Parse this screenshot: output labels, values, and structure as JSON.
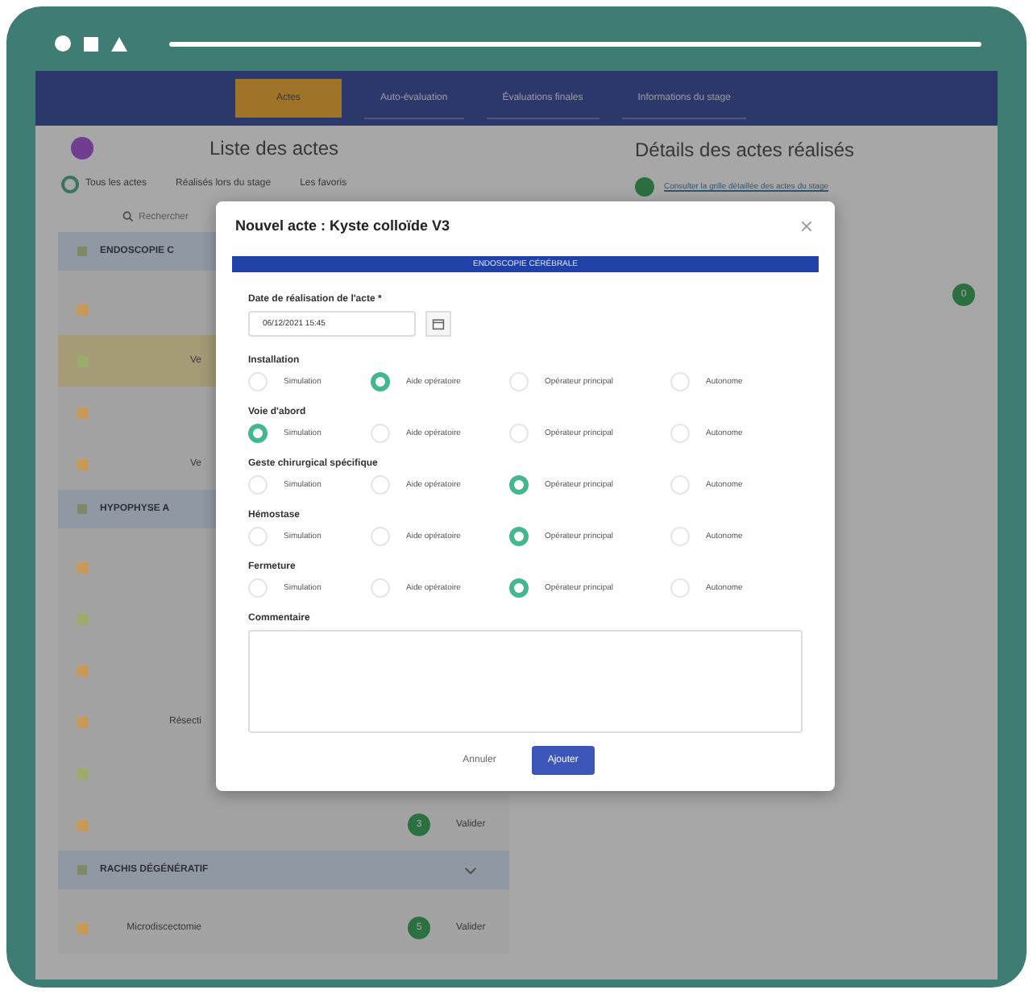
{
  "nav": {
    "tabs": [
      {
        "label": "Actes",
        "selected": true
      },
      {
        "label": "Auto-évaluation",
        "selected": false
      },
      {
        "label": "Évaluations finales",
        "selected": false
      },
      {
        "label": "Informations du stage",
        "selected": false
      }
    ]
  },
  "list_panel": {
    "title": "Liste des actes",
    "filters": [
      {
        "label": "Tous les actes",
        "selected": true
      },
      {
        "label": "Réalisés lors du stage",
        "selected": false
      },
      {
        "label": "Les favoris",
        "selected": false
      }
    ],
    "search_placeholder": "Rechercher",
    "groups": [
      {
        "title": "ENDOSCOPIE C",
        "rows": [
          {
            "label": "",
            "color": "#c99a55",
            "highlighted": false
          },
          {
            "label": "Ve",
            "color": "#9aab6a",
            "highlighted": true
          },
          {
            "label": "",
            "color": "#c99a55",
            "highlighted": false
          },
          {
            "label": "Ve",
            "color": "#c99a55",
            "highlighted": false
          }
        ]
      },
      {
        "title": "HYPOPHYSE A",
        "rows": [
          {
            "label": "",
            "color": "#c99a55",
            "highlighted": false
          },
          {
            "label": "",
            "color": "#9aab6a",
            "highlighted": false
          },
          {
            "label": "",
            "color": "#c99a55",
            "highlighted": false
          },
          {
            "label": "Résecti",
            "color": "#c99a55",
            "highlighted": false
          },
          {
            "label": "",
            "color": "#9aab6a",
            "highlighted": false
          },
          {
            "label": "",
            "color": "#c99a55",
            "highlighted": false,
            "count": "3",
            "action": "Valider"
          }
        ]
      },
      {
        "title": "RACHIS DÉGÉNÉRATIF",
        "rows": [
          {
            "label": "Microdiscectomie",
            "color": "#c99a55",
            "highlighted": false,
            "count": "5",
            "action": "Valider"
          }
        ]
      }
    ]
  },
  "details_panel": {
    "title": "Détails des actes réalisés",
    "link": "Consulter la grille détaillée des actes du stage",
    "count": "0"
  },
  "modal": {
    "title": "Nouvel acte : Kyste colloïde V3",
    "banner": "ENDOSCOPIE CÉRÉBRALE",
    "date_label": "Date de réalisation de l'acte *",
    "date_value": "06/12/2021 15:45",
    "sections": [
      {
        "label": "Installation",
        "options": [
          {
            "label": "Simulation",
            "selected": false
          },
          {
            "label": "Aide opératoire",
            "selected": true
          },
          {
            "label": "Opérateur principal",
            "selected": false
          },
          {
            "label": "Autonome",
            "selected": false
          }
        ]
      },
      {
        "label": "Voie d'abord",
        "options": [
          {
            "label": "Simulation",
            "selected": true
          },
          {
            "label": "Aide opératoire",
            "selected": false
          },
          {
            "label": "Opérateur principal",
            "selected": false
          },
          {
            "label": "Autonome",
            "selected": false
          }
        ]
      },
      {
        "label": "Geste chirurgical spécifique",
        "options": [
          {
            "label": "Simulation",
            "selected": false
          },
          {
            "label": "Aide opératoire",
            "selected": false
          },
          {
            "label": "Opérateur principal",
            "selected": true
          },
          {
            "label": "Autonome",
            "selected": false
          }
        ]
      },
      {
        "label": "Hémostase",
        "options": [
          {
            "label": "Simulation",
            "selected": false
          },
          {
            "label": "Aide opératoire",
            "selected": false
          },
          {
            "label": "Opérateur principal",
            "selected": true
          },
          {
            "label": "Autonome",
            "selected": false
          }
        ]
      },
      {
        "label": "Fermeture",
        "options": [
          {
            "label": "Simulation",
            "selected": false
          },
          {
            "label": "Aide opératoire",
            "selected": false
          },
          {
            "label": "Opérateur principal",
            "selected": true
          },
          {
            "label": "Autonome",
            "selected": false
          }
        ]
      }
    ],
    "comment_label": "Commentaire",
    "buttons": [
      {
        "label": "Annuler",
        "kind": "cancel"
      },
      {
        "label": "Ajouter",
        "kind": "primary"
      }
    ]
  }
}
